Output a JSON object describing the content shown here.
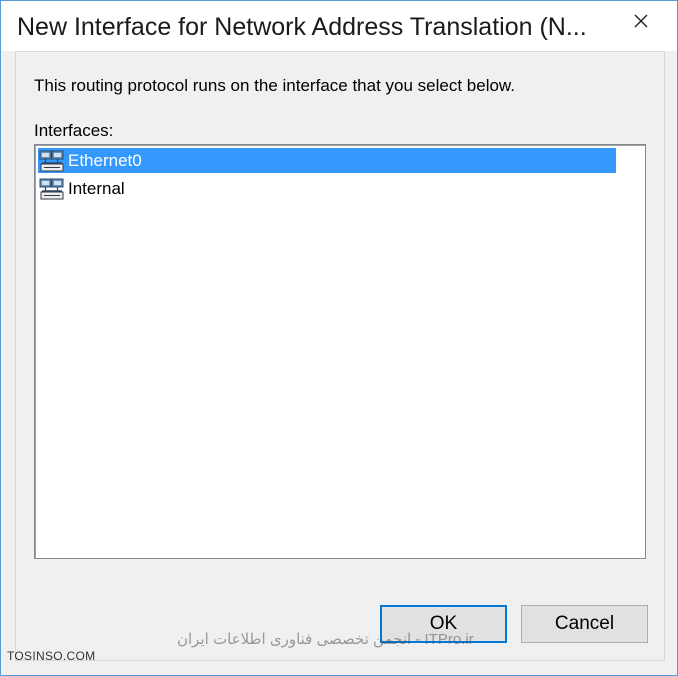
{
  "window": {
    "title": "New Interface for Network Address Translation (N..."
  },
  "dialog": {
    "description": "This routing protocol runs on the interface that you select below.",
    "interfaces_label": "Interfaces:",
    "interfaces": [
      {
        "label": "Ethernet0",
        "selected": true,
        "icon": "network-adapter-icon"
      },
      {
        "label": "Internal",
        "selected": false,
        "icon": "network-adapter-icon"
      }
    ]
  },
  "buttons": {
    "ok_label": "OK",
    "cancel_label": "Cancel"
  },
  "watermark": {
    "left": "TOSINSO.COM",
    "right": "ITPro.ir - انجمن تخصصی فناوری اطلاعات ایران"
  },
  "colors": {
    "selection": "#3399ff",
    "window_border": "#5a9bd6",
    "default_button_border": "#0078d7"
  }
}
